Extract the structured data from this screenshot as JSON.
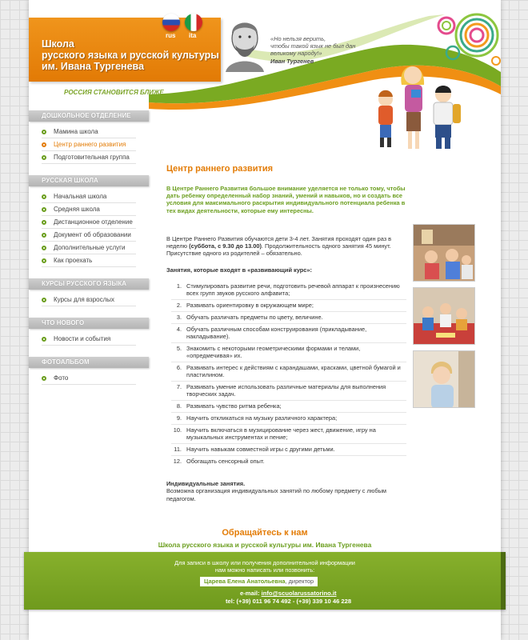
{
  "header": {
    "title_lines": [
      "Школа",
      "русского языка и русской культуры",
      "им. Ивана Тургенева"
    ],
    "languages": [
      {
        "code": "rus"
      },
      {
        "code": "ita"
      }
    ],
    "slogan": "РОССИЯ СТАНОВИТСЯ БЛИЖЕ",
    "quote_lines": [
      "«Но нельзя верить,",
      "чтобы такой язык не был дан",
      "великому народу!»"
    ],
    "quote_author": "Иван Тургенев"
  },
  "sidebar": {
    "sections": [
      {
        "title": "ДОШКОЛЬНОЕ ОТДЕЛЕНИЕ",
        "items": [
          "Мамина школа",
          "Центр раннего развития",
          "Подготовительная группа"
        ],
        "active_index": 1
      },
      {
        "title": "РУССКАЯ ШКОЛА",
        "items": [
          "Начальная школа",
          "Средняя школа",
          "Дистанционное отделение",
          "Документ об образовании",
          "Дополнительные услуги",
          "Как проехать"
        ]
      },
      {
        "title": "КУРСЫ РУССКОГО ЯЗЫКА",
        "items": [
          "Курсы для взрослых"
        ]
      },
      {
        "title": "ЧТО НОВОГО",
        "items": [
          "Новости и события"
        ]
      },
      {
        "title": "ФОТОАЛЬБОМ",
        "items": [
          "Фото"
        ]
      }
    ]
  },
  "main": {
    "title": "Центр раннего развития",
    "intro": "В Центре Раннего Развития большое внимание уделяется не только тому, чтобы дать ребенку определенный набор знаний, умений и навыков, но и создать все условия для максимального раскрытия индивидуального потенциала ребенка в тех видах деятельности, которые ему интересны.",
    "para_start": "В Центре Раннего Развития обучаются дети 3-4 лет. Занятия проходят один раз в неделю ",
    "para_bold": "(суббота, с 9.30 до 13.00)",
    "para_end": ". Продолжительность одного занятия 45 минут. Присутствие одного из родителей – обязательно.",
    "list_title": "Занятия, которые входят в «развивающий курс»:",
    "list": [
      "Стимулировать развитие речи, подготовить речевой аппарат к произнесению всех групп звуков русского алфавита;",
      "Развивать ориентировку в окружающем мире;",
      "Обучать различать предметы по цвету, величине.",
      "Обучать различным способам конструирования (прикладывание, накладывание).",
      "Знакомить с некоторыми геометрическими формами и телами, «опредмечивая» их.",
      "Развивать интерес к действиям с карандашами, красками, цветной бумагой и пластилином.",
      "Развивать умение использовать различные материалы для выполнения творческих задач.",
      "Развивать чувство ритма ребенка;",
      "Научить откликаться на музыку различного характера;",
      "Научить включаться в музицирование через жест, движение, игру на музыкальных инструментах и пение;",
      "Научить навыкам совместной игры с другими детьми.",
      "Обогащать сенсорный опыт."
    ],
    "individual_title": "Индивидуальные занятия.",
    "individual_text": "Возможна организация индивидуальных занятий по любому предмету с любым педагогом."
  },
  "contact": {
    "title": "Обращайтесь к нам",
    "subtitle": "Школа русского языка и русской культуры им. Ивана Тургенева",
    "info_lines": [
      "Для записи в школу или получения дополнительной информации",
      "нам можно написать или позвонить:"
    ],
    "person_name": "Царева Елена Анатольевна",
    "person_role": ", директор",
    "email_label": "e-mail:",
    "email": "info@scuolarussatorino.it",
    "phone_label": "tel:",
    "phone": "(+39) 011 96 74 492 - (+39) 339 10 46 228"
  },
  "colors": {
    "accent_orange": "#e37c06",
    "accent_green": "#6b9e1e",
    "footer_green": "#7aa625"
  }
}
